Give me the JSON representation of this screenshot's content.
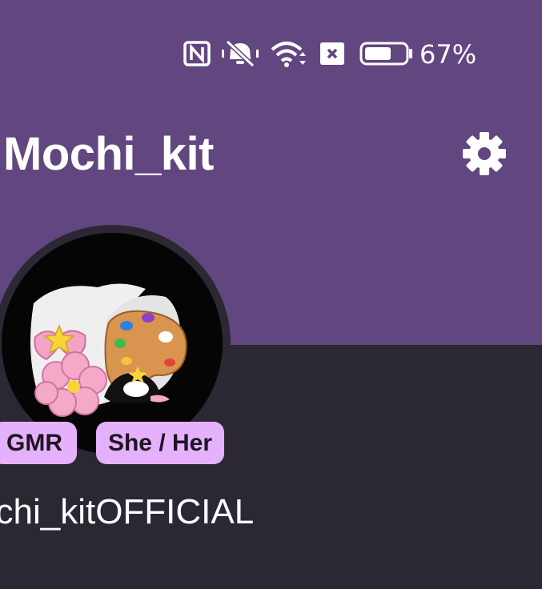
{
  "status_bar": {
    "battery_percent": "67%",
    "icons": [
      "nfc-icon",
      "vibrate-off-icon",
      "wifi-icon",
      "sim-off-icon",
      "battery-icon"
    ],
    "battery_level": 0.67
  },
  "header": {
    "title": "Mochi_kit",
    "settings_icon": "gear-icon"
  },
  "profile": {
    "avatar": "avatar-image",
    "badges": [
      "GMR",
      "She / Her"
    ],
    "username": "ochi_kitOFFICIAL"
  },
  "colors": {
    "banner": "#62467f",
    "background": "#2b2833",
    "badge": "#e6b1fb"
  }
}
